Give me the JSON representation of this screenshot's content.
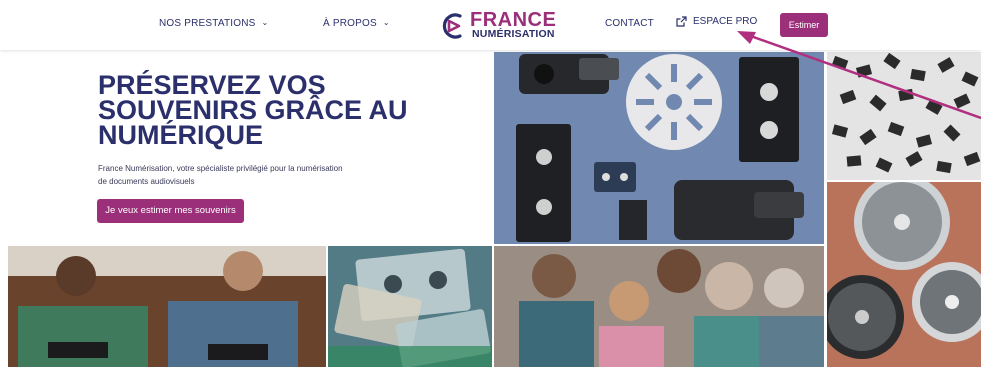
{
  "nav": {
    "prestations": "NOS PRESTATIONS",
    "apropos": "À PROPOS",
    "contact": "CONTACT",
    "espace_pro": "ESPACE PRO",
    "estimer": "Estimer"
  },
  "logo": {
    "line1": "FRANCE",
    "line2": "NUMÉRISATION"
  },
  "hero": {
    "title": "PRÉSERVEZ VOS SOUVENIRS GRÂCE AU NUMÉRIQUE",
    "subtitle_line1": "France Numérisation, votre spécialiste privilégié pour la numérisation",
    "subtitle_line2": "de documents audiovisuels",
    "cta": "Je veux estimer mes souvenirs"
  },
  "colors": {
    "brand_purple": "#9b2f79",
    "brand_navy": "#2b2f6b",
    "annotation_arrow": "#b0307f"
  },
  "images": [
    {
      "name": "camcorder-tapes-reel-photo"
    },
    {
      "name": "photo-slides-photo"
    },
    {
      "name": "film-reels-photo"
    },
    {
      "name": "friends-laughing-photo"
    },
    {
      "name": "cassette-tapes-photo"
    },
    {
      "name": "family-with-tablet-photo"
    }
  ]
}
